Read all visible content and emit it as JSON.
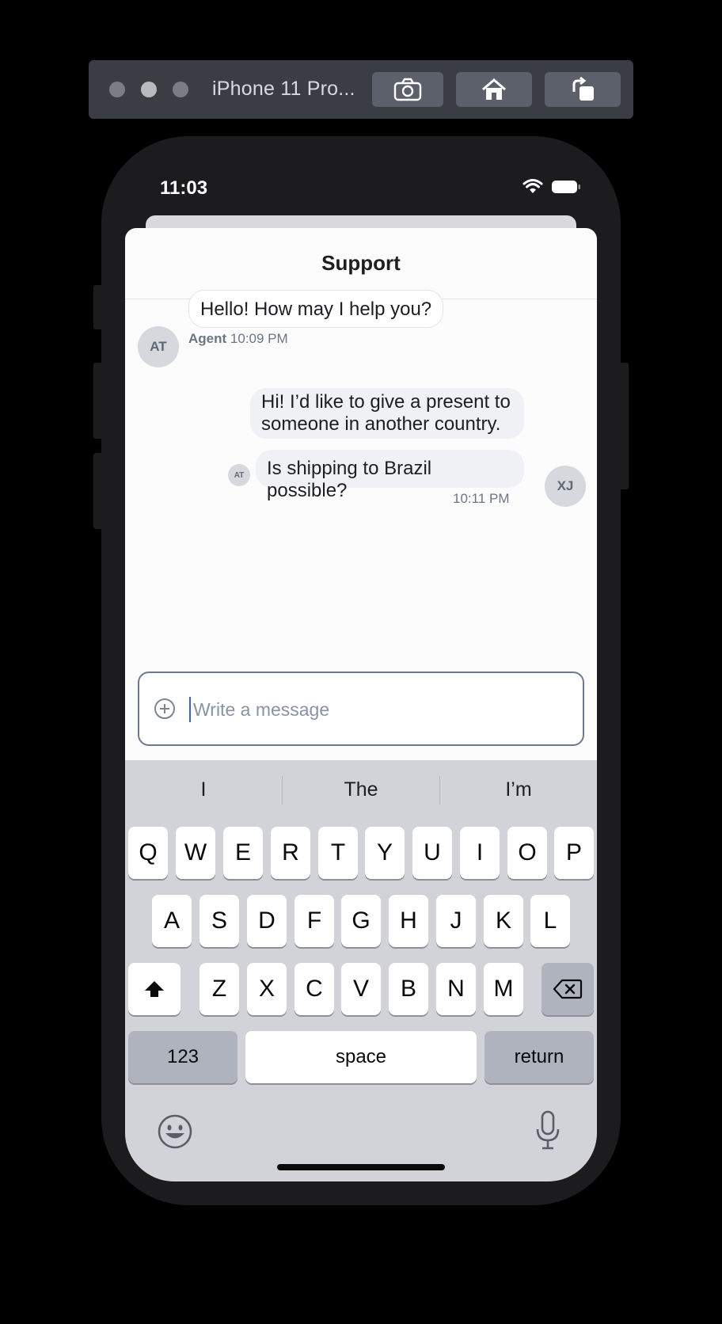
{
  "simulator": {
    "title": "iPhone 11 Pro...",
    "buttons": [
      "screenshot-button",
      "home-button",
      "rotate-button"
    ]
  },
  "status_bar": {
    "time": "11:03"
  },
  "header": {
    "title": "Support"
  },
  "messages": {
    "agent_avatar": "AT",
    "agent_text": "Hello! How may I help you?",
    "agent_name": "Agent",
    "agent_time": "10:09 PM",
    "user_line1": "Hi! I’d like to give a present to",
    "user_line2": "someone in another country.",
    "user_text2": "Is shipping to Brazil possible?",
    "read_avatar": "AT",
    "user_time": "10:11 PM",
    "user_avatar": "XJ"
  },
  "composer": {
    "placeholder": "Write a message",
    "value": ""
  },
  "keyboard": {
    "suggestions": [
      "I",
      "The",
      "I’m"
    ],
    "row1": [
      "Q",
      "W",
      "E",
      "R",
      "T",
      "Y",
      "U",
      "I",
      "O",
      "P"
    ],
    "row2": [
      "A",
      "S",
      "D",
      "F",
      "G",
      "H",
      "J",
      "K",
      "L"
    ],
    "row3": [
      "Z",
      "X",
      "C",
      "V",
      "B",
      "N",
      "M"
    ],
    "numbers_label": "123",
    "space_label": "space",
    "return_label": "return"
  },
  "colors": {
    "accent_border": "#6e7891",
    "keyboard_bg": "#d1d3d9",
    "phone_frame": "#1c1c1e"
  }
}
